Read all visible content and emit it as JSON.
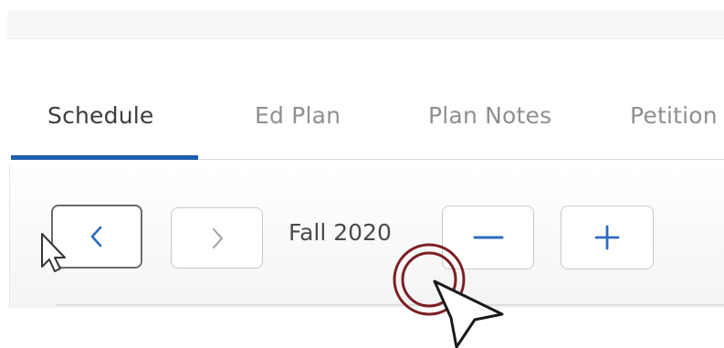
{
  "tabs": [
    {
      "label": "Schedule",
      "active": true
    },
    {
      "label": "Ed Plan",
      "active": false
    },
    {
      "label": "Plan Notes",
      "active": false
    },
    {
      "label": "Petition",
      "active": false
    }
  ],
  "toolbar": {
    "prev_icon": "chevron-left-icon",
    "next_icon": "chevron-right-icon",
    "term_label": "Fall 2020",
    "remove_icon": "minus-icon",
    "add_icon": "plus-icon"
  },
  "colors": {
    "accent": "#1f5fad",
    "click_ring": "#7a1f24",
    "tab_inactive": "#8f8f8f",
    "tab_active": "#3c3c3c"
  }
}
